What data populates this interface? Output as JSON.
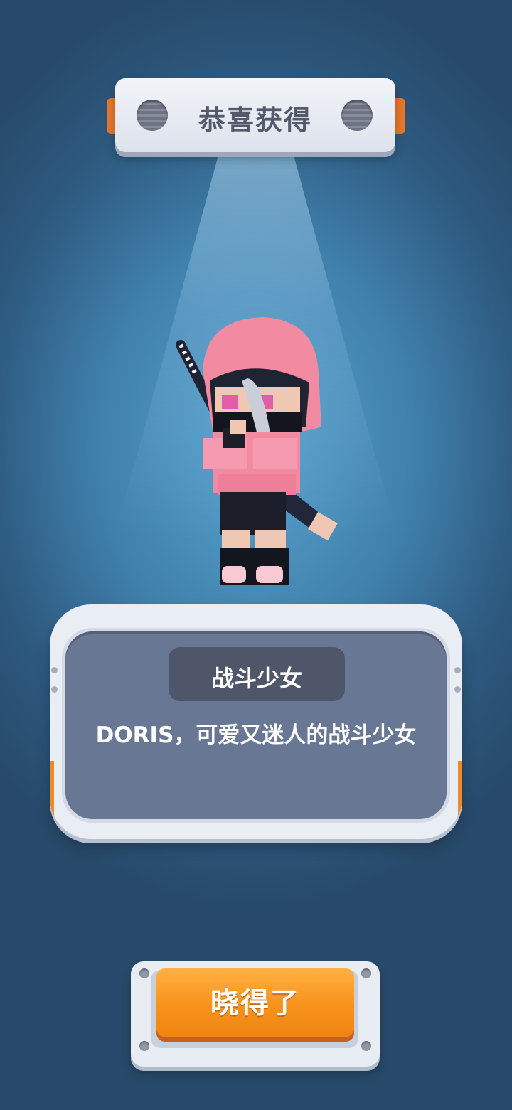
{
  "header": {
    "title": "恭喜获得"
  },
  "character": {
    "icon": "ninja-girl-character",
    "hood_color": "#f28aa2"
  },
  "info": {
    "name": "战斗少女",
    "description": "DORIS，可爱又迷人的战斗少女"
  },
  "actions": {
    "confirm_label": "晓得了"
  },
  "colors": {
    "accent": "#f7931c",
    "panel": "#687794",
    "background": "#3f7fab"
  }
}
